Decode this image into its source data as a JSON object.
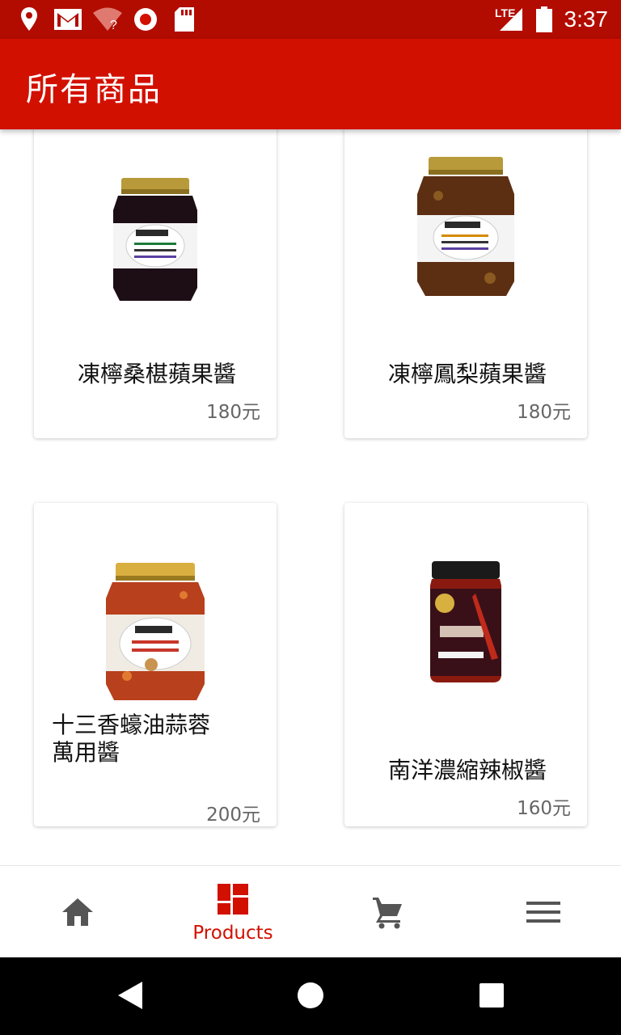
{
  "status_bar": {
    "time": "3:37",
    "network": "LTE",
    "icons": [
      "location-icon",
      "gmail-icon",
      "wifi-unknown-icon",
      "record-icon",
      "sd-card-icon",
      "signal-icon",
      "battery-icon"
    ]
  },
  "app_bar": {
    "title": "所有商品"
  },
  "products": [
    {
      "name": "凍檸桑椹蘋果醬",
      "price": "180元"
    },
    {
      "name": "凍檸鳳梨蘋果醬",
      "price": "180元"
    },
    {
      "name": "十三香蠔油蒜蓉萬用醬",
      "price": "200元"
    },
    {
      "name": "南洋濃縮辣椒醬",
      "price": "160元"
    }
  ],
  "bottom_nav": {
    "items": [
      {
        "icon": "home-icon",
        "label": ""
      },
      {
        "icon": "products-icon",
        "label": "Products"
      },
      {
        "icon": "cart-icon",
        "label": ""
      },
      {
        "icon": "menu-icon",
        "label": ""
      }
    ],
    "active_index": 1
  },
  "colors": {
    "status_bar": "#b20c00",
    "app_bar": "#d21000",
    "accent": "#d21000",
    "inactive_icon": "#555555"
  }
}
